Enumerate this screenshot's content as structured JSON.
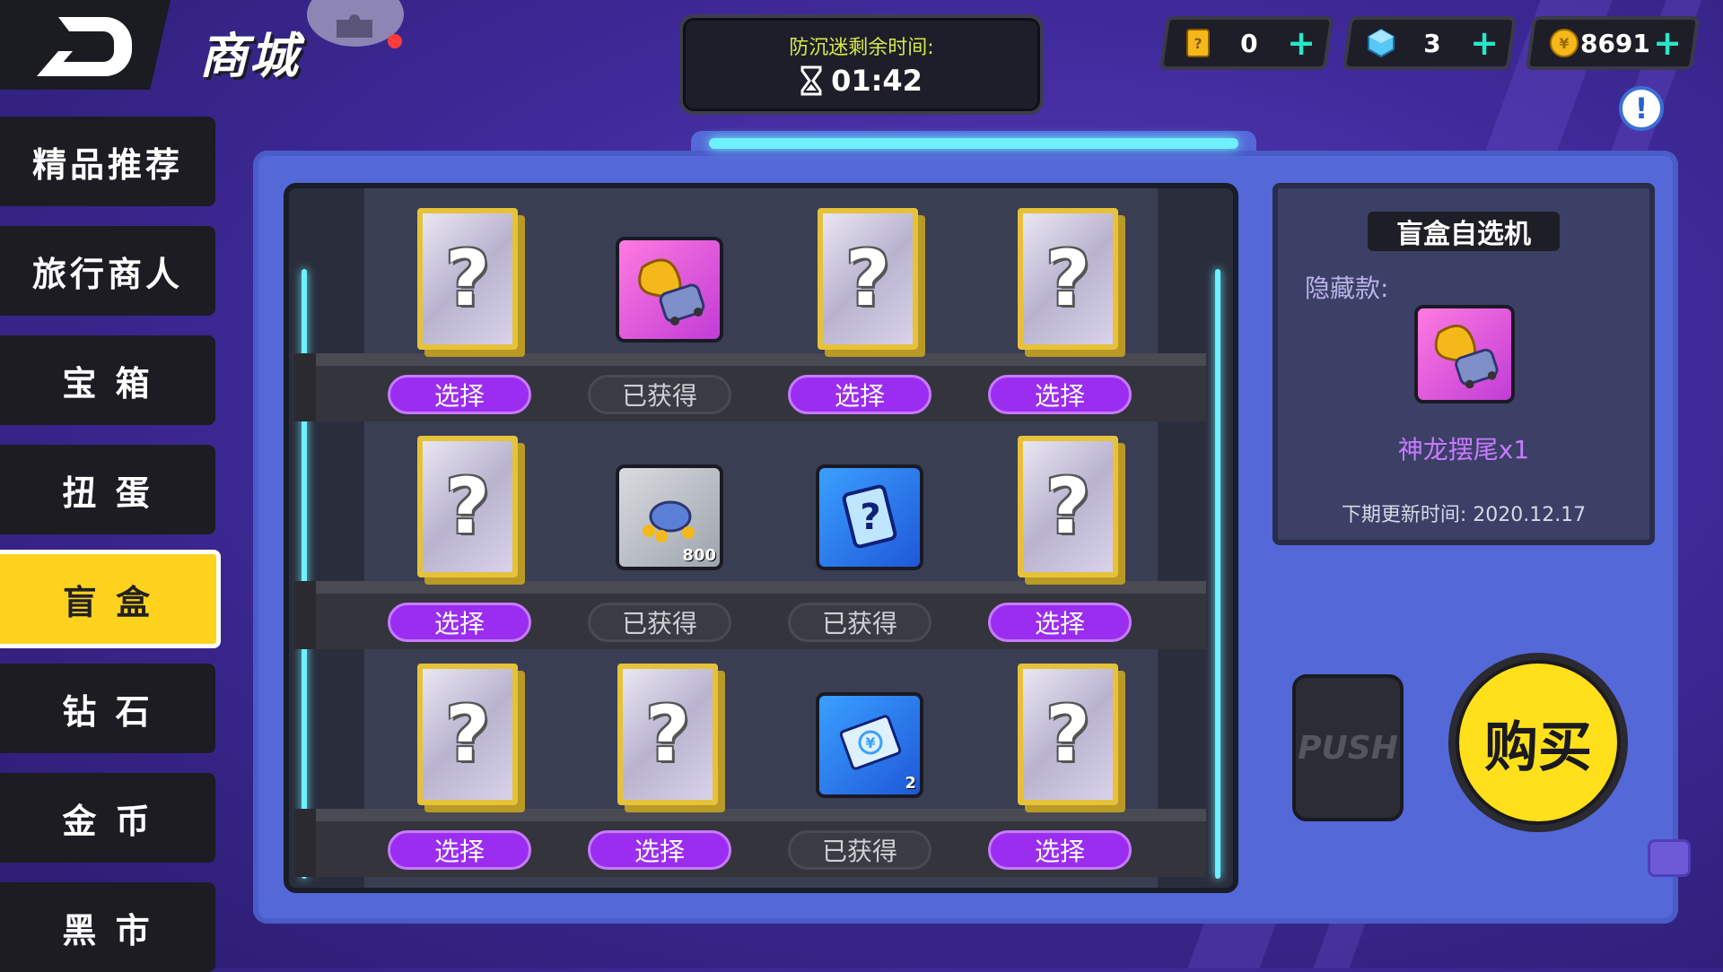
{
  "header": {
    "title": "商城"
  },
  "timer": {
    "label": "防沉迷剩余时间:",
    "value": "01:42"
  },
  "currencies": [
    {
      "name": "ticket",
      "icon": "ticket-icon",
      "value": "0"
    },
    {
      "name": "diamond",
      "icon": "diamond-icon",
      "value": "3"
    },
    {
      "name": "coin",
      "icon": "coin-icon",
      "value": "8691"
    }
  ],
  "sidebar": {
    "items": [
      {
        "label": "精品推荐"
      },
      {
        "label": "旅行商人"
      },
      {
        "label": "宝 箱"
      },
      {
        "label": "扭 蛋"
      },
      {
        "label": "盲 盒",
        "active": true
      },
      {
        "label": "钻 石"
      },
      {
        "label": "金 币"
      },
      {
        "label": "黑 市"
      }
    ]
  },
  "grid": {
    "select_label": "选择",
    "obtained_label": "已获得",
    "rows": [
      [
        {
          "type": "mystery",
          "state": "select"
        },
        {
          "type": "dragon-tail",
          "state": "obtained"
        },
        {
          "type": "mystery",
          "state": "select"
        },
        {
          "type": "mystery",
          "state": "select"
        }
      ],
      [
        {
          "type": "mystery",
          "state": "select"
        },
        {
          "type": "coins-pile",
          "qty": "800",
          "state": "obtained"
        },
        {
          "type": "random-card",
          "state": "obtained"
        },
        {
          "type": "mystery",
          "state": "select"
        }
      ],
      [
        {
          "type": "mystery",
          "state": "select"
        },
        {
          "type": "mystery",
          "state": "select"
        },
        {
          "type": "coupon",
          "qty": "2",
          "state": "obtained"
        },
        {
          "type": "mystery",
          "state": "select"
        }
      ]
    ]
  },
  "info": {
    "title": "盲盒自选机",
    "hidden_label": "隐藏款:",
    "hidden_item": "神龙摆尾x1",
    "next_update": "下期更新时间: 2020.12.17"
  },
  "actions": {
    "push": "PUSH",
    "buy": "购买"
  },
  "colors": {
    "accent": "#ffd21e",
    "select": "#9b2df0",
    "neon": "#6ef0ff",
    "panel": "#5468d8"
  }
}
